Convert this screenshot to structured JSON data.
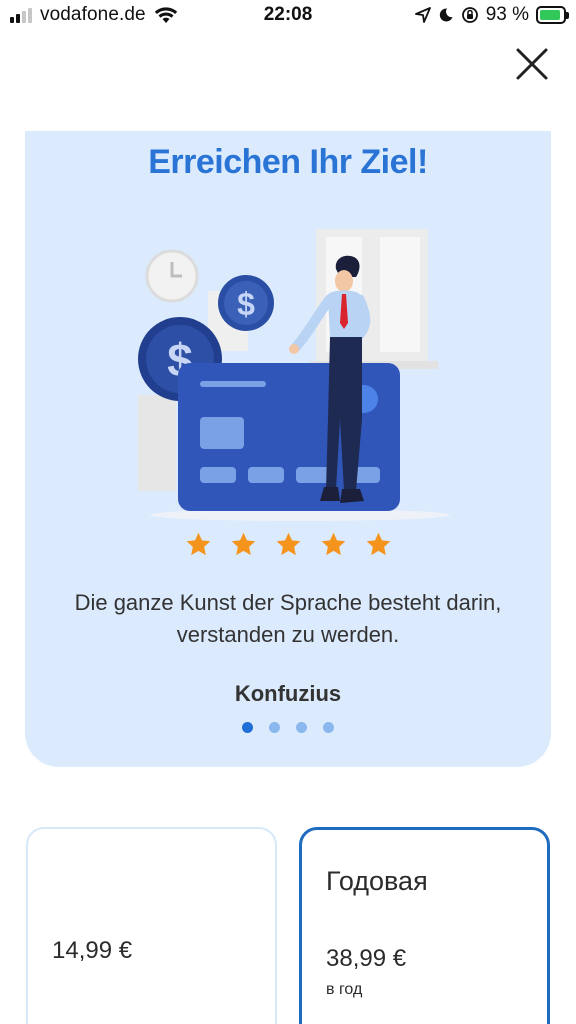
{
  "status_bar": {
    "carrier": "vodafone.de",
    "time": "22:08",
    "battery_percent": "93 %",
    "battery_level": 0.93,
    "icons": [
      "signal-icon",
      "wifi-icon",
      "location-icon",
      "moon-icon",
      "orientation-lock-icon",
      "battery-icon"
    ]
  },
  "close_icon": "close-icon",
  "promo": {
    "title": "Erreichen Ihr Ziel!",
    "stars": 5,
    "quote": "Die ganze Kunst der Sprache besteht darin, verstanden zu werden.",
    "author": "Konfuzius",
    "slides_total": 4,
    "active_slide": 1
  },
  "plans": [
    {
      "name": "",
      "price": "14,99 €",
      "period": "",
      "selected": false
    },
    {
      "name": "Годовая",
      "price": "38,99 €",
      "period": "в год",
      "selected": true
    }
  ],
  "colors": {
    "accent": "#2a74d6",
    "card_bg": "#dbeafd",
    "star": "#f5941d",
    "selected_border": "#1e6bbf"
  }
}
